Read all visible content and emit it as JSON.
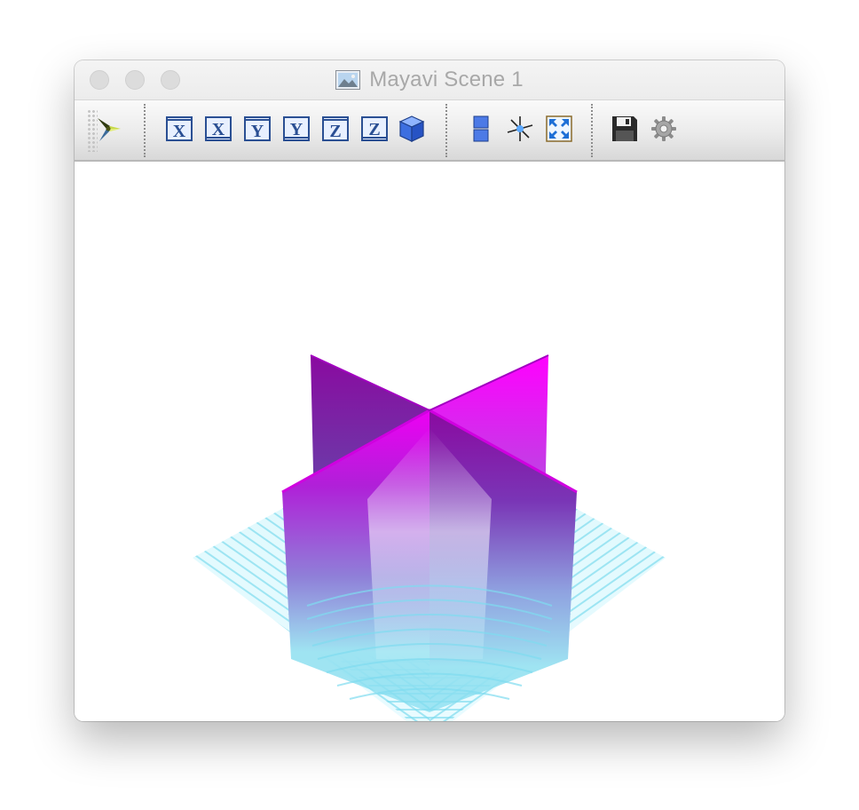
{
  "window": {
    "title": "Mayavi Scene 1"
  },
  "toolbar": {
    "items": [
      {
        "name": "mayavi-logo-icon"
      },
      {
        "name": "view-x-positive-button",
        "label": "X"
      },
      {
        "name": "view-x-negative-button",
        "label": "X"
      },
      {
        "name": "view-y-positive-button",
        "label": "Y"
      },
      {
        "name": "view-y-negative-button",
        "label": "Y"
      },
      {
        "name": "view-z-positive-button",
        "label": "Z"
      },
      {
        "name": "view-z-negative-button",
        "label": "Z"
      },
      {
        "name": "isometric-view-button"
      },
      {
        "name": "parallel-projection-button"
      },
      {
        "name": "show-axes-button"
      },
      {
        "name": "full-screen-button"
      },
      {
        "name": "save-button"
      },
      {
        "name": "configure-scene-button"
      }
    ]
  },
  "scene": {
    "colors": {
      "magenta": "#ff00ff",
      "purple": "#8a0aa0",
      "cyan": "#7fdcef",
      "light_cyan": "#d8f7fc",
      "blue": "#6f8fd9"
    }
  }
}
